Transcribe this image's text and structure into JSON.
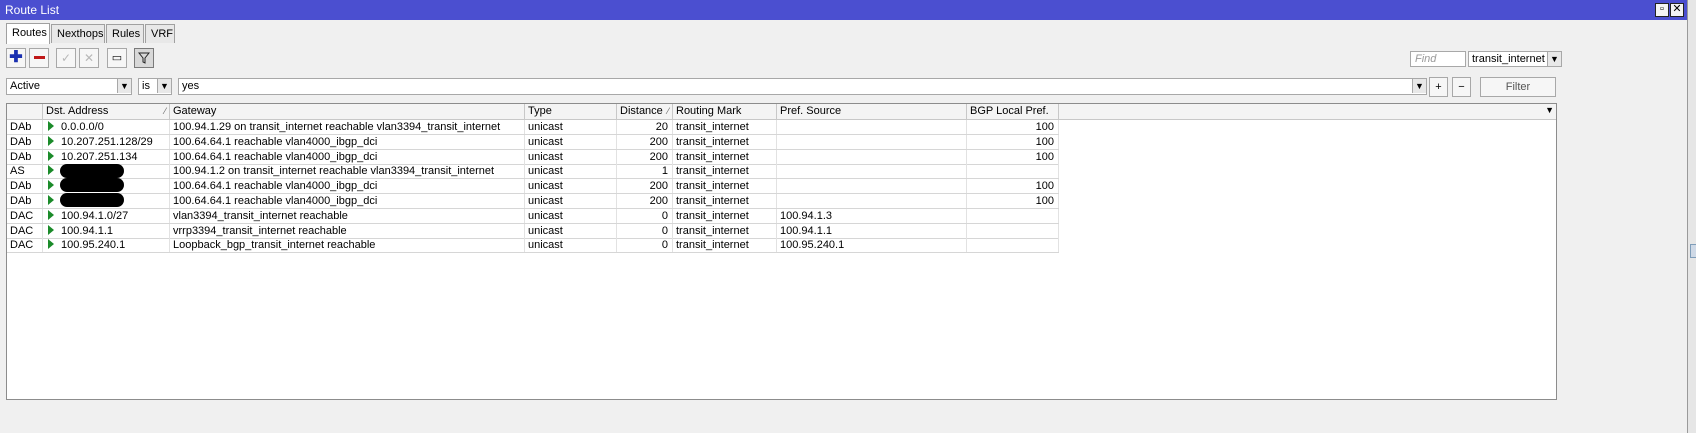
{
  "window": {
    "title": "Route List"
  },
  "tabs": [
    {
      "label": "Routes",
      "active": true
    },
    {
      "label": "Nexthops",
      "active": false
    },
    {
      "label": "Rules",
      "active": false
    },
    {
      "label": "VRF",
      "active": false
    }
  ],
  "toolbar": {
    "add_icon": "plus-icon",
    "remove_icon": "minus-icon",
    "enable_icon": "check-icon",
    "disable_icon": "x-icon",
    "comment_icon": "comment-icon",
    "filter_icon": "funnel-icon",
    "find_placeholder": "Find",
    "routing_mark_select": "transit_internet"
  },
  "filter": {
    "field": "Active",
    "operator": "is",
    "value": "yes",
    "add_label": "+",
    "remove_label": "−",
    "filter_button": "Filter"
  },
  "columns": [
    {
      "label": ""
    },
    {
      "label": "Dst. Address",
      "sortable": true
    },
    {
      "label": "Gateway"
    },
    {
      "label": "Type"
    },
    {
      "label": "Distance",
      "sortable": true
    },
    {
      "label": "Routing Mark"
    },
    {
      "label": "Pref. Source"
    },
    {
      "label": "BGP Local Pref."
    }
  ],
  "rows": [
    {
      "flags": "DAb",
      "dst": "0.0.0.0/0",
      "gateway": "100.94.1.29 on transit_internet reachable vlan3394_transit_internet",
      "type": "unicast",
      "distance": "20",
      "mark": "transit_internet",
      "pref_src": "",
      "bgp_pref": "100",
      "redacted": false
    },
    {
      "flags": "DAb",
      "dst": "10.207.251.128/29",
      "gateway": "100.64.64.1 reachable vlan4000_ibgp_dci",
      "type": "unicast",
      "distance": "200",
      "mark": "transit_internet",
      "pref_src": "",
      "bgp_pref": "100",
      "redacted": false
    },
    {
      "flags": "DAb",
      "dst": "10.207.251.134",
      "gateway": "100.64.64.1 reachable vlan4000_ibgp_dci",
      "type": "unicast",
      "distance": "200",
      "mark": "transit_internet",
      "pref_src": "",
      "bgp_pref": "100",
      "redacted": false
    },
    {
      "flags": "AS",
      "dst": "",
      "gateway": "100.94.1.2 on transit_internet reachable vlan3394_transit_internet",
      "type": "unicast",
      "distance": "1",
      "mark": "transit_internet",
      "pref_src": "",
      "bgp_pref": "",
      "redacted": true
    },
    {
      "flags": "DAb",
      "dst": "",
      "gateway": "100.64.64.1 reachable vlan4000_ibgp_dci",
      "type": "unicast",
      "distance": "200",
      "mark": "transit_internet",
      "pref_src": "",
      "bgp_pref": "100",
      "redacted": true
    },
    {
      "flags": "DAb",
      "dst": "",
      "gateway": "100.64.64.1 reachable vlan4000_ibgp_dci",
      "type": "unicast",
      "distance": "200",
      "mark": "transit_internet",
      "pref_src": "",
      "bgp_pref": "100",
      "redacted": true
    },
    {
      "flags": "DAC",
      "dst": "100.94.1.0/27",
      "gateway": "vlan3394_transit_internet reachable",
      "type": "unicast",
      "distance": "0",
      "mark": "transit_internet",
      "pref_src": "100.94.1.3",
      "bgp_pref": "",
      "redacted": false
    },
    {
      "flags": "DAC",
      "dst": "100.94.1.1",
      "gateway": "vrrp3394_transit_internet reachable",
      "type": "unicast",
      "distance": "0",
      "mark": "transit_internet",
      "pref_src": "100.94.1.1",
      "bgp_pref": "",
      "redacted": false
    },
    {
      "flags": "DAC",
      "dst": "100.95.240.1",
      "gateway": "Loopback_bgp_transit_internet reachable",
      "type": "unicast",
      "distance": "0",
      "mark": "transit_internet",
      "pref_src": "100.95.240.1",
      "bgp_pref": "",
      "redacted": false
    }
  ],
  "colors": {
    "titlebar": "#4b4fd0",
    "active_arrow": "#1b8b2a",
    "add": "#1a2fb0",
    "remove": "#c01818"
  }
}
